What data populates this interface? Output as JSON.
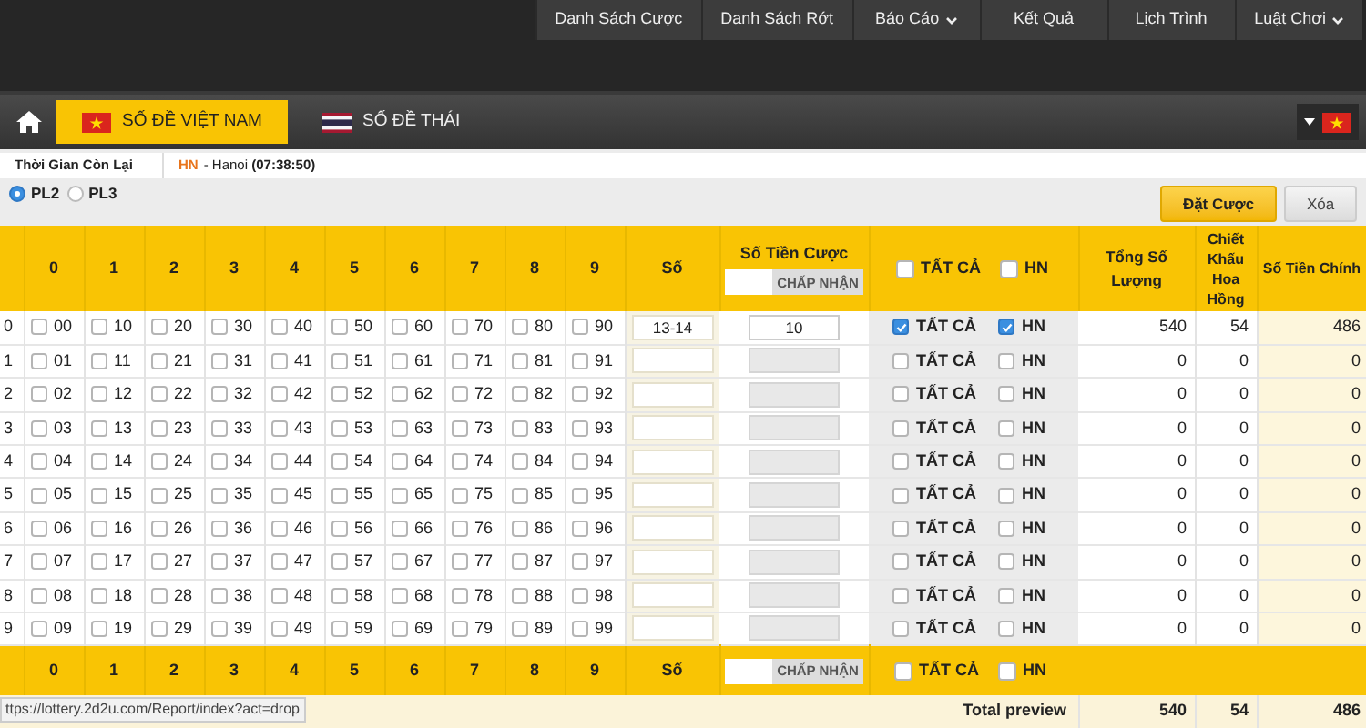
{
  "top_menu": [
    {
      "label": "Danh Sách Cược",
      "dropdown": false
    },
    {
      "label": "Danh Sách Rớt",
      "dropdown": false
    },
    {
      "label": "Báo Cáo",
      "dropdown": true
    },
    {
      "label": "Kết Quả",
      "dropdown": false
    },
    {
      "label": "Lịch Trình",
      "dropdown": false
    },
    {
      "label": "Luật Chơi",
      "dropdown": true
    }
  ],
  "nav": {
    "tabs": [
      {
        "label": "SỐ ĐỀ VIỆT NAM",
        "kind": "vn",
        "selected": true
      },
      {
        "label": "SỐ ĐỀ THÁI",
        "kind": "th",
        "selected": false
      }
    ],
    "language": {
      "kind": "vn"
    }
  },
  "countdown": {
    "label": "Thời Gian Còn Lại",
    "region_code": "HN",
    "region_text": "- Hanoi **(07:38:50)**"
  },
  "modes": [
    {
      "label": "PL2",
      "selected": true
    },
    {
      "label": "PL3",
      "selected": false
    }
  ],
  "buttons": [
    {
      "label": "Đặt Cược",
      "kind": "primary"
    },
    {
      "label": "Xóa",
      "kind": "secondary"
    }
  ],
  "table": {
    "header": {
      "digits": [
        "0",
        "1",
        "2",
        "3",
        "4",
        "5",
        "6",
        "7",
        "8",
        "9"
      ],
      "so": "Số",
      "amount_label": "Số Tiền Cược",
      "accept": "CHẤP NHẬN",
      "all": {
        "label": "TẤT CẢ",
        "checked": false
      },
      "hn": {
        "label": "HN",
        "checked": false
      },
      "total": "Tổng Số Lượng",
      "discount": "Chiết Khấu Hoa Hồng",
      "net": "Số Tiền Chính"
    },
    "rows": [
      {
        "label": "0",
        "numbers": [
          {
            "n": "00",
            "checked": false
          },
          {
            "n": "10",
            "checked": false
          },
          {
            "n": "20",
            "checked": false
          },
          {
            "n": "30",
            "checked": false
          },
          {
            "n": "40",
            "checked": false
          },
          {
            "n": "50",
            "checked": false
          },
          {
            "n": "60",
            "checked": false
          },
          {
            "n": "70",
            "checked": false
          },
          {
            "n": "80",
            "checked": false
          },
          {
            "n": "90",
            "checked": false
          }
        ],
        "so": "13-14",
        "amount": "10",
        "amount_disabled": false,
        "all": {
          "label": "TẤT CẢ",
          "checked": true
        },
        "hn": {
          "label": "HN",
          "checked": true
        },
        "total": "540",
        "discount": "54",
        "net": "486"
      },
      {
        "label": "1",
        "numbers": [
          {
            "n": "01",
            "checked": false
          },
          {
            "n": "11",
            "checked": false
          },
          {
            "n": "21",
            "checked": false
          },
          {
            "n": "31",
            "checked": false
          },
          {
            "n": "41",
            "checked": false
          },
          {
            "n": "51",
            "checked": false
          },
          {
            "n": "61",
            "checked": false
          },
          {
            "n": "71",
            "checked": false
          },
          {
            "n": "81",
            "checked": false
          },
          {
            "n": "91",
            "checked": false
          }
        ],
        "amount_disabled": true,
        "all": {
          "label": "TẤT CẢ",
          "checked": false
        },
        "hn": {
          "label": "HN",
          "checked": false
        },
        "total": "0",
        "discount": "0",
        "net": "0"
      },
      {
        "label": "2",
        "numbers": [
          {
            "n": "02",
            "checked": false
          },
          {
            "n": "12",
            "checked": false
          },
          {
            "n": "22",
            "checked": false
          },
          {
            "n": "32",
            "checked": false
          },
          {
            "n": "42",
            "checked": false
          },
          {
            "n": "52",
            "checked": false
          },
          {
            "n": "62",
            "checked": false
          },
          {
            "n": "72",
            "checked": false
          },
          {
            "n": "82",
            "checked": false
          },
          {
            "n": "92",
            "checked": false
          }
        ],
        "amount_disabled": true,
        "all": {
          "label": "TẤT CẢ",
          "checked": false
        },
        "hn": {
          "label": "HN",
          "checked": false
        },
        "total": "0",
        "discount": "0",
        "net": "0"
      },
      {
        "label": "3",
        "numbers": [
          {
            "n": "03",
            "checked": false
          },
          {
            "n": "13",
            "checked": false
          },
          {
            "n": "23",
            "checked": false
          },
          {
            "n": "33",
            "checked": false
          },
          {
            "n": "43",
            "checked": false
          },
          {
            "n": "53",
            "checked": false
          },
          {
            "n": "63",
            "checked": false
          },
          {
            "n": "73",
            "checked": false
          },
          {
            "n": "83",
            "checked": false
          },
          {
            "n": "93",
            "checked": false
          }
        ],
        "amount_disabled": true,
        "all": {
          "label": "TẤT CẢ",
          "checked": false
        },
        "hn": {
          "label": "HN",
          "checked": false
        },
        "total": "0",
        "discount": "0",
        "net": "0"
      },
      {
        "label": "4",
        "numbers": [
          {
            "n": "04",
            "checked": false
          },
          {
            "n": "14",
            "checked": false
          },
          {
            "n": "24",
            "checked": false
          },
          {
            "n": "34",
            "checked": false
          },
          {
            "n": "44",
            "checked": false
          },
          {
            "n": "54",
            "checked": false
          },
          {
            "n": "64",
            "checked": false
          },
          {
            "n": "74",
            "checked": false
          },
          {
            "n": "84",
            "checked": false
          },
          {
            "n": "94",
            "checked": false
          }
        ],
        "amount_disabled": true,
        "all": {
          "label": "TẤT CẢ",
          "checked": false
        },
        "hn": {
          "label": "HN",
          "checked": false
        },
        "total": "0",
        "discount": "0",
        "net": "0"
      },
      {
        "label": "5",
        "numbers": [
          {
            "n": "05",
            "checked": false
          },
          {
            "n": "15",
            "checked": false
          },
          {
            "n": "25",
            "checked": false
          },
          {
            "n": "35",
            "checked": false
          },
          {
            "n": "45",
            "checked": false
          },
          {
            "n": "55",
            "checked": false
          },
          {
            "n": "65",
            "checked": false
          },
          {
            "n": "75",
            "checked": false
          },
          {
            "n": "85",
            "checked": false
          },
          {
            "n": "95",
            "checked": false
          }
        ],
        "amount_disabled": true,
        "all": {
          "label": "TẤT CẢ",
          "checked": false
        },
        "hn": {
          "label": "HN",
          "checked": false
        },
        "total": "0",
        "discount": "0",
        "net": "0"
      },
      {
        "label": "6",
        "numbers": [
          {
            "n": "06",
            "checked": false
          },
          {
            "n": "16",
            "checked": false
          },
          {
            "n": "26",
            "checked": false
          },
          {
            "n": "36",
            "checked": false
          },
          {
            "n": "46",
            "checked": false
          },
          {
            "n": "56",
            "checked": false
          },
          {
            "n": "66",
            "checked": false
          },
          {
            "n": "76",
            "checked": false
          },
          {
            "n": "86",
            "checked": false
          },
          {
            "n": "96",
            "checked": false
          }
        ],
        "amount_disabled": true,
        "all": {
          "label": "TẤT CẢ",
          "checked": false
        },
        "hn": {
          "label": "HN",
          "checked": false
        },
        "total": "0",
        "discount": "0",
        "net": "0"
      },
      {
        "label": "7",
        "numbers": [
          {
            "n": "07",
            "checked": false
          },
          {
            "n": "17",
            "checked": false
          },
          {
            "n": "27",
            "checked": false
          },
          {
            "n": "37",
            "checked": false
          },
          {
            "n": "47",
            "checked": false
          },
          {
            "n": "57",
            "checked": false
          },
          {
            "n": "67",
            "checked": false
          },
          {
            "n": "77",
            "checked": false
          },
          {
            "n": "87",
            "checked": false
          },
          {
            "n": "97",
            "checked": false
          }
        ],
        "amount_disabled": true,
        "all": {
          "label": "TẤT CẢ",
          "checked": false
        },
        "hn": {
          "label": "HN",
          "checked": false
        },
        "total": "0",
        "discount": "0",
        "net": "0"
      },
      {
        "label": "8",
        "numbers": [
          {
            "n": "08",
            "checked": false
          },
          {
            "n": "18",
            "checked": false
          },
          {
            "n": "28",
            "checked": false
          },
          {
            "n": "38",
            "checked": false
          },
          {
            "n": "48",
            "checked": false
          },
          {
            "n": "58",
            "checked": false
          },
          {
            "n": "68",
            "checked": false
          },
          {
            "n": "78",
            "checked": false
          },
          {
            "n": "88",
            "checked": false
          },
          {
            "n": "98",
            "checked": false
          }
        ],
        "amount_disabled": true,
        "all": {
          "label": "TẤT CẢ",
          "checked": false
        },
        "hn": {
          "label": "HN",
          "checked": false
        },
        "total": "0",
        "discount": "0",
        "net": "0"
      },
      {
        "label": "9",
        "numbers": [
          {
            "n": "09",
            "checked": false
          },
          {
            "n": "19",
            "checked": false
          },
          {
            "n": "29",
            "checked": false
          },
          {
            "n": "39",
            "checked": false
          },
          {
            "n": "49",
            "checked": false
          },
          {
            "n": "59",
            "checked": false
          },
          {
            "n": "69",
            "checked": false
          },
          {
            "n": "79",
            "checked": false
          },
          {
            "n": "89",
            "checked": false
          },
          {
            "n": "99",
            "checked": false
          }
        ],
        "amount_disabled": true,
        "all": {
          "label": "TẤT CẢ",
          "checked": false
        },
        "hn": {
          "label": "HN",
          "checked": false
        },
        "total": "0",
        "discount": "0",
        "net": "0"
      }
    ],
    "footer": {
      "digits": [
        "0",
        "1",
        "2",
        "3",
        "4",
        "5",
        "6",
        "7",
        "8",
        "9"
      ],
      "so": "Số",
      "accept": "CHẤP NHẬN",
      "all": {
        "label": "TẤT CẢ",
        "checked": false
      },
      "hn": {
        "label": "HN",
        "checked": false
      }
    },
    "total_row": {
      "label": "Total preview",
      "total": "540",
      "discount": "54",
      "net": "486"
    }
  },
  "status_bar": "ttps://lottery.2d2u.com/Report/index?act=drop"
}
